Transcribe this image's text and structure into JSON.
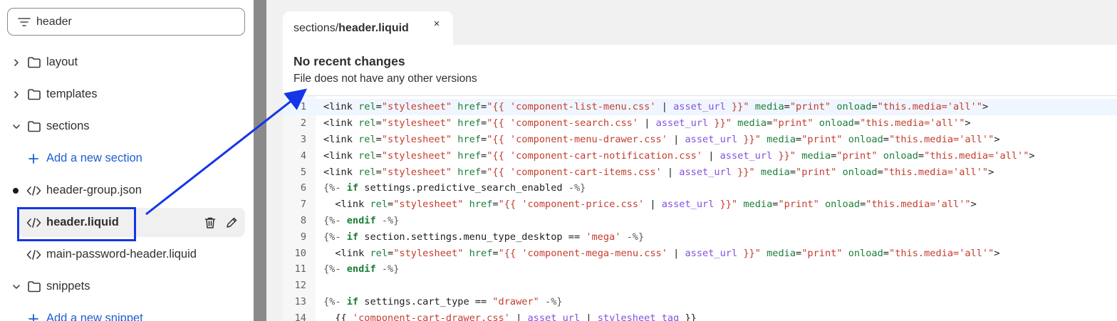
{
  "search": {
    "value": "header",
    "icon": "filter-icon"
  },
  "tree": [
    {
      "type": "folder",
      "label": "layout",
      "expanded": false
    },
    {
      "type": "folder",
      "label": "templates",
      "expanded": false
    },
    {
      "type": "folder",
      "label": "sections",
      "expanded": true
    },
    {
      "type": "add",
      "label": "Add a new section"
    },
    {
      "type": "file",
      "label": "header-group.json",
      "modified": true
    },
    {
      "type": "file",
      "label": "header.liquid",
      "selected": true
    },
    {
      "type": "file",
      "label": "main-password-header.liquid"
    },
    {
      "type": "folder",
      "label": "snippets",
      "expanded": true
    },
    {
      "type": "add",
      "label": "Add a new snippet"
    }
  ],
  "tab": {
    "path_prefix": "sections/",
    "path_file": "header.liquid",
    "close": "×"
  },
  "status": {
    "title": "No recent changes",
    "subtitle": "File does not have any other versions"
  },
  "colors": {
    "accent": "#1f5fd1",
    "highlight": "#1436e6",
    "selected_bg": "#f0f0f0"
  },
  "code_lines": [
    {
      "n": "1",
      "html": "<span class=\"t-tag\">&lt;link </span><span class=\"t-attr\">rel</span>=<span class=\"t-str\">\"stylesheet\"</span> <span class=\"t-attr\">href</span>=<span class=\"t-str\">\"{{ 'component-list-menu.css' </span>| <span class=\"t-filter\">asset_url</span> <span class=\"t-str\">}}\"</span> <span class=\"t-attr\">media</span>=<span class=\"t-str\">\"print\"</span> <span class=\"t-attr\">onload</span>=<span class=\"t-str\">\"this.media='all'\"</span>&gt;"
    },
    {
      "n": "2",
      "html": "&lt;link <span class=\"t-attr\">rel</span>=<span class=\"t-str\">\"stylesheet\"</span> <span class=\"t-attr\">href</span>=<span class=\"t-str\">\"{{ 'component-search.css' </span>| <span class=\"t-filter\">asset_url</span> <span class=\"t-str\">}}\"</span> <span class=\"t-attr\">media</span>=<span class=\"t-str\">\"print\"</span> <span class=\"t-attr\">onload</span>=<span class=\"t-str\">\"this.media='all'\"</span>&gt;"
    },
    {
      "n": "3",
      "html": "&lt;link <span class=\"t-attr\">rel</span>=<span class=\"t-str\">\"stylesheet\"</span> <span class=\"t-attr\">href</span>=<span class=\"t-str\">\"{{ 'component-menu-drawer.css' </span>| <span class=\"t-filter\">asset_url</span> <span class=\"t-str\">}}\"</span> <span class=\"t-attr\">media</span>=<span class=\"t-str\">\"print\"</span> <span class=\"t-attr\">onload</span>=<span class=\"t-str\">\"this.media='all'\"</span>&gt;"
    },
    {
      "n": "4",
      "html": "&lt;link <span class=\"t-attr\">rel</span>=<span class=\"t-str\">\"stylesheet\"</span> <span class=\"t-attr\">href</span>=<span class=\"t-str\">\"{{ 'component-cart-notification.css' </span>| <span class=\"t-filter\">asset_url</span> <span class=\"t-str\">}}\"</span> <span class=\"t-attr\">media</span>=<span class=\"t-str\">\"print\"</span> <span class=\"t-attr\">onload</span>=<span class=\"t-str\">\"this.media='all'\"</span>&gt;"
    },
    {
      "n": "5",
      "html": "&lt;link <span class=\"t-attr\">rel</span>=<span class=\"t-str\">\"stylesheet\"</span> <span class=\"t-attr\">href</span>=<span class=\"t-str\">\"{{ 'component-cart-items.css' </span>| <span class=\"t-filter\">asset_url</span> <span class=\"t-str\">}}\"</span> <span class=\"t-attr\">media</span>=<span class=\"t-str\">\"print\"</span> <span class=\"t-attr\">onload</span>=<span class=\"t-str\">\"this.media='all'\"</span>&gt;"
    },
    {
      "n": "6",
      "html": "<span class=\"t-liq\">{%- </span><span class=\"t-kw\">if</span> settings.predictive_search_enabled <span class=\"t-liq\">-%}</span>"
    },
    {
      "n": "7",
      "html": "  &lt;link <span class=\"t-attr\">rel</span>=<span class=\"t-str\">\"stylesheet\"</span> <span class=\"t-attr\">href</span>=<span class=\"t-str\">\"{{ 'component-price.css' </span>| <span class=\"t-filter\">asset_url</span> <span class=\"t-str\">}}\"</span> <span class=\"t-attr\">media</span>=<span class=\"t-str\">\"print\"</span> <span class=\"t-attr\">onload</span>=<span class=\"t-str\">\"this.media='all'\"</span>&gt;"
    },
    {
      "n": "8",
      "html": "<span class=\"t-liq\">{%- </span><span class=\"t-kw\">endif</span> <span class=\"t-liq\">-%}</span>"
    },
    {
      "n": "9",
      "html": "<span class=\"t-liq\">{%- </span><span class=\"t-kw\">if</span> section.settings.menu_type_desktop == <span class=\"t-str\">'mega'</span> <span class=\"t-liq\">-%}</span>"
    },
    {
      "n": "10",
      "html": "  &lt;link <span class=\"t-attr\">rel</span>=<span class=\"t-str\">\"stylesheet\"</span> <span class=\"t-attr\">href</span>=<span class=\"t-str\">\"{{ 'component-mega-menu.css' </span>| <span class=\"t-filter\">asset_url</span> <span class=\"t-str\">}}\"</span> <span class=\"t-attr\">media</span>=<span class=\"t-str\">\"print\"</span> <span class=\"t-attr\">onload</span>=<span class=\"t-str\">\"this.media='all'\"</span>&gt;"
    },
    {
      "n": "11",
      "html": "<span class=\"t-liq\">{%- </span><span class=\"t-kw\">endif</span> <span class=\"t-liq\">-%}</span>"
    },
    {
      "n": "12",
      "html": ""
    },
    {
      "n": "13",
      "html": "<span class=\"t-liq\">{%- </span><span class=\"t-kw\">if</span> settings.cart_type == <span class=\"t-str\">\"drawer\"</span> <span class=\"t-liq\">-%}</span>"
    },
    {
      "n": "14",
      "html": "  {{ <span class=\"t-str\">'component-cart-drawer.css'</span> | <span class=\"t-filter\">asset_url</span> | <span class=\"t-filter\">stylesheet_tag</span> }}"
    }
  ]
}
